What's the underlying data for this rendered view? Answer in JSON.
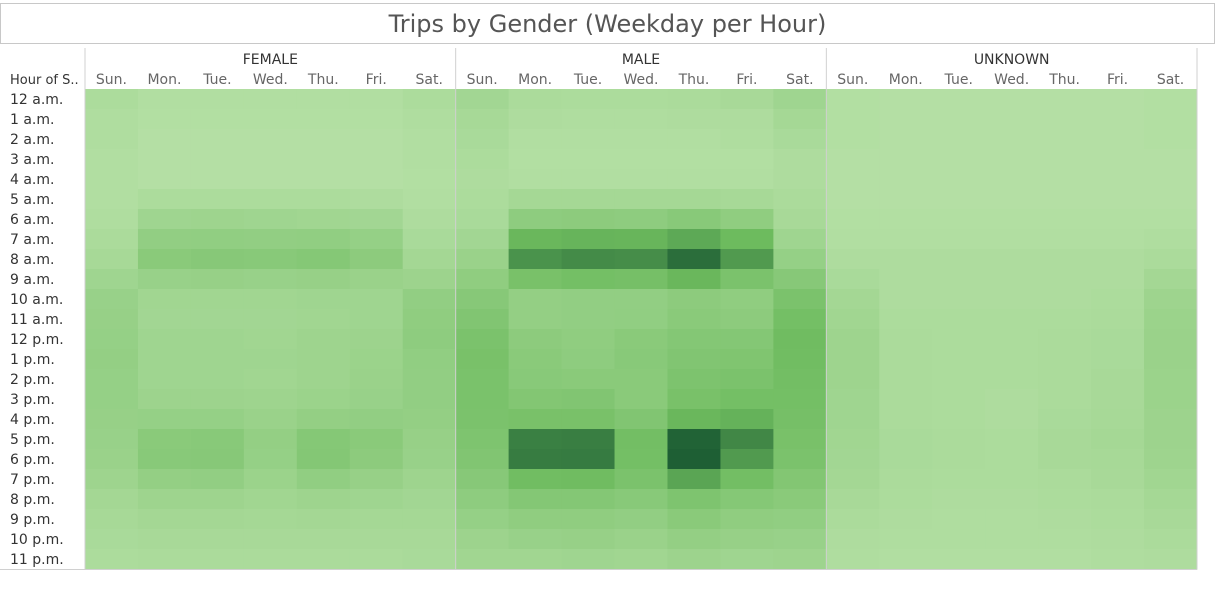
{
  "title": "Trips by Gender (Weekday per Hour)",
  "chart_data": {
    "type": "heatmap",
    "title": "Trips by Gender (Weekday per Hour)",
    "row_header": "Hour of S..",
    "groups": [
      "FEMALE",
      "MALE",
      "UNKNOWN"
    ],
    "days": [
      "Sun.",
      "Mon.",
      "Tue.",
      "Wed.",
      "Thu.",
      "Fri.",
      "Sat."
    ],
    "hours": [
      "12 a.m.",
      "1 a.m.",
      "2 a.m.",
      "3 a.m.",
      "4 a.m.",
      "5 a.m.",
      "6 a.m.",
      "7 a.m.",
      "8 a.m.",
      "9 a.m.",
      "10 a.m.",
      "11 a.m.",
      "12 p.m.",
      "1 p.m.",
      "2 p.m.",
      "3 p.m.",
      "4 p.m.",
      "5 p.m.",
      "6 p.m.",
      "7 p.m.",
      "8 p.m.",
      "9 p.m.",
      "10 p.m.",
      "11 p.m."
    ],
    "color_scale": {
      "low": "#b5e0a5",
      "mid": "#6dbb5e",
      "high": "#1e5f34",
      "min_value": 0,
      "max_value": 1
    },
    "values_note_units": "relative intensity 0-1",
    "values": {
      "FEMALE": [
        [
          0.06,
          0.03,
          0.03,
          0.03,
          0.03,
          0.03,
          0.06
        ],
        [
          0.04,
          0.02,
          0.02,
          0.02,
          0.02,
          0.02,
          0.04
        ],
        [
          0.04,
          0.01,
          0.01,
          0.01,
          0.01,
          0.01,
          0.03
        ],
        [
          0.03,
          0.01,
          0.01,
          0.01,
          0.01,
          0.01,
          0.03
        ],
        [
          0.03,
          0.01,
          0.01,
          0.01,
          0.01,
          0.01,
          0.02
        ],
        [
          0.03,
          0.06,
          0.06,
          0.06,
          0.06,
          0.05,
          0.03
        ],
        [
          0.04,
          0.15,
          0.16,
          0.15,
          0.14,
          0.13,
          0.05
        ],
        [
          0.07,
          0.24,
          0.25,
          0.24,
          0.25,
          0.22,
          0.08
        ],
        [
          0.1,
          0.3,
          0.32,
          0.31,
          0.33,
          0.28,
          0.12
        ],
        [
          0.15,
          0.2,
          0.21,
          0.2,
          0.21,
          0.19,
          0.17
        ],
        [
          0.2,
          0.14,
          0.14,
          0.14,
          0.15,
          0.15,
          0.24
        ],
        [
          0.21,
          0.13,
          0.13,
          0.13,
          0.14,
          0.15,
          0.26
        ],
        [
          0.22,
          0.15,
          0.15,
          0.14,
          0.16,
          0.17,
          0.27
        ],
        [
          0.23,
          0.15,
          0.15,
          0.15,
          0.16,
          0.18,
          0.25
        ],
        [
          0.22,
          0.15,
          0.15,
          0.14,
          0.16,
          0.19,
          0.24
        ],
        [
          0.22,
          0.17,
          0.17,
          0.16,
          0.18,
          0.2,
          0.24
        ],
        [
          0.21,
          0.22,
          0.22,
          0.19,
          0.23,
          0.24,
          0.23
        ],
        [
          0.2,
          0.3,
          0.31,
          0.23,
          0.33,
          0.3,
          0.21
        ],
        [
          0.19,
          0.31,
          0.32,
          0.22,
          0.34,
          0.28,
          0.2
        ],
        [
          0.16,
          0.23,
          0.24,
          0.18,
          0.25,
          0.21,
          0.16
        ],
        [
          0.12,
          0.16,
          0.16,
          0.14,
          0.16,
          0.15,
          0.13
        ],
        [
          0.1,
          0.12,
          0.12,
          0.11,
          0.12,
          0.11,
          0.11
        ],
        [
          0.08,
          0.09,
          0.09,
          0.09,
          0.09,
          0.09,
          0.09
        ],
        [
          0.06,
          0.07,
          0.07,
          0.07,
          0.07,
          0.07,
          0.08
        ]
      ],
      "MALE": [
        [
          0.13,
          0.07,
          0.06,
          0.06,
          0.07,
          0.09,
          0.15
        ],
        [
          0.1,
          0.05,
          0.04,
          0.04,
          0.05,
          0.05,
          0.11
        ],
        [
          0.08,
          0.03,
          0.03,
          0.03,
          0.03,
          0.04,
          0.08
        ],
        [
          0.06,
          0.02,
          0.02,
          0.02,
          0.02,
          0.02,
          0.05
        ],
        [
          0.05,
          0.03,
          0.03,
          0.03,
          0.03,
          0.03,
          0.05
        ],
        [
          0.06,
          0.11,
          0.11,
          0.11,
          0.11,
          0.1,
          0.07
        ],
        [
          0.08,
          0.27,
          0.28,
          0.27,
          0.31,
          0.26,
          0.09
        ],
        [
          0.13,
          0.52,
          0.54,
          0.53,
          0.6,
          0.5,
          0.15
        ],
        [
          0.19,
          0.72,
          0.76,
          0.75,
          0.92,
          0.68,
          0.22
        ],
        [
          0.26,
          0.42,
          0.45,
          0.44,
          0.52,
          0.4,
          0.32
        ],
        [
          0.32,
          0.23,
          0.24,
          0.24,
          0.28,
          0.26,
          0.4
        ],
        [
          0.36,
          0.23,
          0.24,
          0.25,
          0.3,
          0.28,
          0.45
        ],
        [
          0.4,
          0.28,
          0.26,
          0.3,
          0.34,
          0.34,
          0.48
        ],
        [
          0.42,
          0.3,
          0.27,
          0.31,
          0.36,
          0.37,
          0.47
        ],
        [
          0.41,
          0.31,
          0.3,
          0.3,
          0.39,
          0.4,
          0.46
        ],
        [
          0.41,
          0.35,
          0.36,
          0.3,
          0.42,
          0.45,
          0.45
        ],
        [
          0.4,
          0.42,
          0.42,
          0.36,
          0.52,
          0.55,
          0.44
        ],
        [
          0.38,
          0.82,
          0.83,
          0.46,
          0.98,
          0.78,
          0.42
        ],
        [
          0.36,
          0.84,
          0.85,
          0.45,
          1.0,
          0.68,
          0.4
        ],
        [
          0.32,
          0.47,
          0.48,
          0.4,
          0.62,
          0.46,
          0.35
        ],
        [
          0.27,
          0.34,
          0.34,
          0.31,
          0.38,
          0.33,
          0.3
        ],
        [
          0.22,
          0.26,
          0.26,
          0.24,
          0.3,
          0.26,
          0.25
        ],
        [
          0.17,
          0.2,
          0.21,
          0.19,
          0.23,
          0.21,
          0.2
        ],
        [
          0.14,
          0.14,
          0.15,
          0.14,
          0.17,
          0.15,
          0.16
        ]
      ],
      "UNKNOWN": [
        [
          0.02,
          0.01,
          0.01,
          0.01,
          0.01,
          0.01,
          0.02
        ],
        [
          0.02,
          0.01,
          0.01,
          0.01,
          0.01,
          0.01,
          0.02
        ],
        [
          0.02,
          0.01,
          0.01,
          0.01,
          0.01,
          0.01,
          0.02
        ],
        [
          0.01,
          0.01,
          0.01,
          0.01,
          0.01,
          0.01,
          0.01
        ],
        [
          0.01,
          0.01,
          0.01,
          0.01,
          0.01,
          0.01,
          0.01
        ],
        [
          0.01,
          0.01,
          0.01,
          0.01,
          0.01,
          0.01,
          0.01
        ],
        [
          0.02,
          0.02,
          0.02,
          0.02,
          0.02,
          0.02,
          0.02
        ],
        [
          0.03,
          0.03,
          0.03,
          0.03,
          0.03,
          0.03,
          0.04
        ],
        [
          0.05,
          0.05,
          0.05,
          0.05,
          0.05,
          0.05,
          0.07
        ],
        [
          0.08,
          0.05,
          0.05,
          0.05,
          0.05,
          0.05,
          0.12
        ],
        [
          0.12,
          0.05,
          0.05,
          0.05,
          0.05,
          0.06,
          0.16
        ],
        [
          0.14,
          0.06,
          0.06,
          0.06,
          0.06,
          0.07,
          0.18
        ],
        [
          0.16,
          0.07,
          0.06,
          0.06,
          0.07,
          0.08,
          0.19
        ],
        [
          0.16,
          0.07,
          0.06,
          0.06,
          0.07,
          0.08,
          0.19
        ],
        [
          0.16,
          0.07,
          0.06,
          0.06,
          0.07,
          0.09,
          0.18
        ],
        [
          0.15,
          0.07,
          0.06,
          0.05,
          0.07,
          0.09,
          0.18
        ],
        [
          0.15,
          0.07,
          0.06,
          0.05,
          0.08,
          0.1,
          0.17
        ],
        [
          0.14,
          0.08,
          0.07,
          0.06,
          0.09,
          0.11,
          0.17
        ],
        [
          0.13,
          0.08,
          0.07,
          0.06,
          0.09,
          0.1,
          0.16
        ],
        [
          0.12,
          0.07,
          0.06,
          0.06,
          0.07,
          0.09,
          0.14
        ],
        [
          0.09,
          0.06,
          0.05,
          0.05,
          0.06,
          0.07,
          0.11
        ],
        [
          0.07,
          0.05,
          0.04,
          0.04,
          0.05,
          0.06,
          0.09
        ],
        [
          0.05,
          0.04,
          0.04,
          0.04,
          0.04,
          0.05,
          0.07
        ],
        [
          0.04,
          0.03,
          0.03,
          0.03,
          0.03,
          0.04,
          0.05
        ]
      ]
    }
  }
}
